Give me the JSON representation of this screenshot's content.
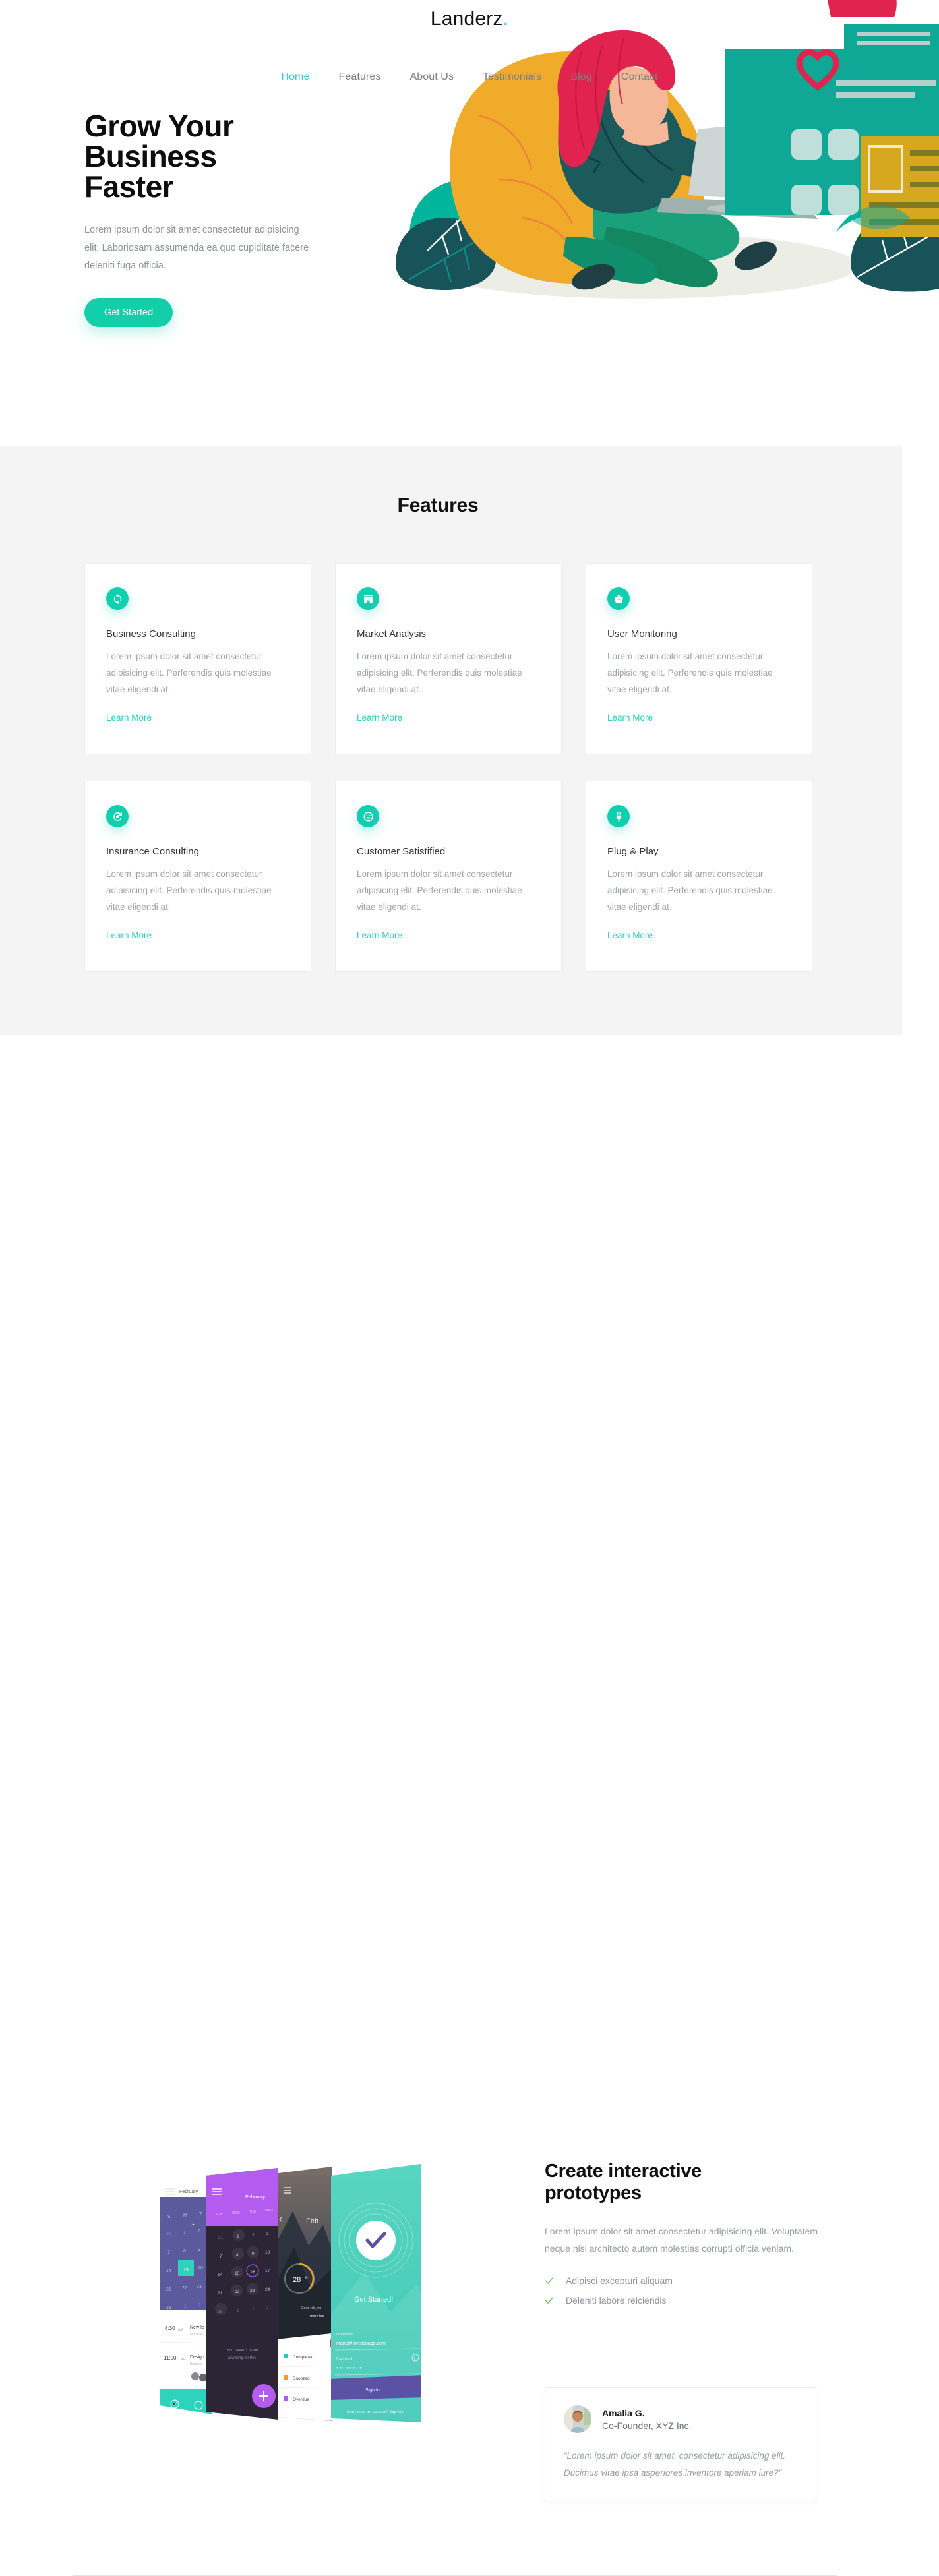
{
  "brand": {
    "name": "Landerz",
    "dot": ".",
    "accent": "#2ad1bb"
  },
  "nav": {
    "items": [
      {
        "label": "Home",
        "active": true
      },
      {
        "label": "Features",
        "active": false
      },
      {
        "label": "About Us",
        "active": false
      },
      {
        "label": "Testimonials",
        "active": false
      },
      {
        "label": "Blog",
        "active": false
      },
      {
        "label": "Contact",
        "active": false
      }
    ]
  },
  "hero": {
    "heading_line1": "Grow Your",
    "heading_line2": "Business",
    "heading_line3": "Faster",
    "paragraph": "Lorem ipsum dolor sit amet consectetur adipisicing elit. Laboriosam assumenda ea quo cupiditate facere deleniti fuga officia.",
    "cta_label": "Get Started",
    "cta_color": "#14ceaa",
    "illustration": "woman-with-laptop-illustration"
  },
  "features": {
    "title": "Features",
    "background": "#f4f4f4",
    "cards": [
      {
        "icon": "sync-icon",
        "title": "Business Consulting",
        "text": "Lorem ipsum dolor sit amet consectetur adipisicing elit. Perferendis quis molestiae vitae eligendi at.",
        "link": "Learn More"
      },
      {
        "icon": "store-icon",
        "title": "Market Analysis",
        "text": "Lorem ipsum dolor sit amet consectetur adipisicing elit. Perferendis quis molestiae vitae eligendi at.",
        "link": "Learn More"
      },
      {
        "icon": "basket-icon",
        "title": "User Monitoring",
        "text": "Lorem ipsum dolor sit amet consectetur adipisicing elit. Perferendis quis molestiae vitae eligendi at.",
        "link": "Learn More"
      },
      {
        "icon": "history-restore-icon",
        "title": "Insurance Consulting",
        "text": "Lorem ipsum dolor sit amet consectetur adipisicing elit. Perferendis quis molestiae vitae eligendi at.",
        "link": "Learn More"
      },
      {
        "icon": "smiley-icon",
        "title": "Customer Satistified",
        "text": "Lorem ipsum dolor sit amet consectetur adipisicing elit. Perferendis quis molestiae vitae eligendi at.",
        "link": "Learn More"
      },
      {
        "icon": "plug-icon",
        "title": "Plug & Play",
        "text": "Lorem ipsum dolor sit amet consectetur adipisicing elit. Perferendis quis molestiae vitae eligendi at.",
        "link": "Learn More"
      }
    ]
  },
  "prototypes": {
    "heading_line1": "Create interactive",
    "heading_line2": "prototypes",
    "paragraph": "Lorem ipsum dolor sit amet consectetur adipisicing elit. Voluptatem neque nisi architecto autem molestias corrupti officia veniam.",
    "checklist": [
      {
        "icon": "check-icon",
        "label": "Adipisci excepturi aliquam"
      },
      {
        "icon": "check-icon",
        "label": "Deleniti labore reiciendis"
      }
    ],
    "check_color": "#6ebe44",
    "mockups": {
      "screen1": {
        "month": "February",
        "weekday_headers": [
          "S",
          "M",
          "T"
        ],
        "dates_row1": [
          "31",
          "1",
          "2"
        ],
        "dates_row2": [
          "7",
          "8",
          "9"
        ],
        "dates_row3": [
          "14",
          "15",
          "16"
        ],
        "dates_row4": [
          "21",
          "22",
          "23"
        ],
        "dates_row5": [
          "28",
          "1",
          "2"
        ],
        "selected_date": "15",
        "events": [
          {
            "time": "8:30",
            "ampm": "AM",
            "title": "New Ico",
            "sub": "Mobile Ap"
          },
          {
            "time": "11:00",
            "ampm": "AM",
            "title": "Design",
            "sub": "Hangouts"
          }
        ]
      },
      "screen2": {
        "month": "February",
        "weekday_headers": [
          "SUN",
          "MON",
          "TUE",
          "WED"
        ],
        "dates_row1": [
          "31",
          "1",
          "2",
          "3"
        ],
        "dates_row2": [
          "7",
          "8",
          "9",
          "10"
        ],
        "dates_row3": [
          "14",
          "15",
          "16",
          "17"
        ],
        "dates_row4": [
          "21",
          "22",
          "23",
          "24"
        ],
        "dates_row5": [
          "28",
          "1",
          "2",
          "3"
        ],
        "highlighted_date": "16",
        "empty_text_line1": "You haven't plann",
        "empty_text_line2": "anything for this",
        "fab": "+"
      },
      "screen3": {
        "title": "Feb",
        "progress_value": "28",
        "progress_unit": "%",
        "message_line1": "Good job, yo",
        "message_line2": "more tas",
        "legend": [
          {
            "label": "Completed",
            "color": "#27cbb8"
          },
          {
            "label": "Snoozed",
            "color": "#f59b26"
          },
          {
            "label": "Overdue",
            "color": "#a65cf0"
          }
        ]
      },
      "screen4": {
        "headline": "Get Started!",
        "username_label": "Username",
        "username_value": "marie@invisionapp.com",
        "password_label": "Password",
        "password_value": "••••••••",
        "signin_label": "Sign In",
        "signup_text": "Don't have an account? Sign Up"
      }
    }
  },
  "testimonial": {
    "avatar": "user-avatar-photo",
    "name": "Amalia G.",
    "role": "Co-Founder, XYZ Inc.",
    "quote": "“Lorem ipsum dolor sit amet, consectetur adipisicing elit. Ducimus vitae ipsa asperiores inventore aperiam iure?”"
  }
}
